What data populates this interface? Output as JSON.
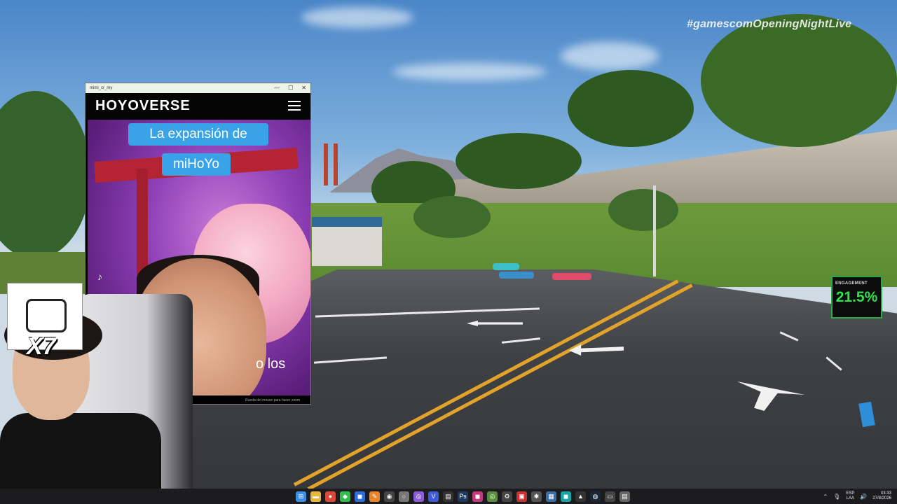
{
  "overlay": {
    "hashtag": "#gamescomOpeningNightLive",
    "engagement_label": "ENGAGEMENT",
    "engagement_value": "21.5%",
    "multiplier": "X7"
  },
  "popup": {
    "window_title": "mimi_cr_my",
    "brand": "HOYOVERSE",
    "caption_line1": "La expansión de",
    "caption_line2": "miHoYo",
    "subtitle_partial": "o los",
    "footer_hint": "Rueda del mouse para hacer zoom",
    "controls": {
      "minimize": "—",
      "maximize": "☐",
      "close": "✕"
    }
  },
  "taskbar": {
    "apps": [
      {
        "name": "start",
        "glyph": "⊞",
        "color": "#3a8ee6"
      },
      {
        "name": "file-explorer",
        "glyph": "▬",
        "color": "#e8b73a"
      },
      {
        "name": "chrome",
        "glyph": "●",
        "color": "#d94a38"
      },
      {
        "name": "app-green",
        "glyph": "◆",
        "color": "#2fbf4a"
      },
      {
        "name": "app-blue",
        "glyph": "◼",
        "color": "#2c6fdc"
      },
      {
        "name": "app-orange",
        "glyph": "✎",
        "color": "#e8832a"
      },
      {
        "name": "obs",
        "glyph": "◉",
        "color": "#444"
      },
      {
        "name": "app-white",
        "glyph": "○",
        "color": "#777"
      },
      {
        "name": "app-purple",
        "glyph": "◎",
        "color": "#8b5cd6"
      },
      {
        "name": "app-v",
        "glyph": "V",
        "color": "#3d5bd9"
      },
      {
        "name": "app-dark",
        "glyph": "▤",
        "color": "#333"
      },
      {
        "name": "photoshop",
        "glyph": "Ps",
        "color": "#1e3a63"
      },
      {
        "name": "app-pink",
        "glyph": "◼",
        "color": "#c23a7a"
      },
      {
        "name": "app-green2",
        "glyph": "◎",
        "color": "#5a8f3d"
      },
      {
        "name": "app-settings",
        "glyph": "⚙",
        "color": "#444"
      },
      {
        "name": "app-red",
        "glyph": "▣",
        "color": "#c73232"
      },
      {
        "name": "app-bug",
        "glyph": "✱",
        "color": "#555"
      },
      {
        "name": "app-media",
        "glyph": "▦",
        "color": "#3a6ea5"
      },
      {
        "name": "app-cyan",
        "glyph": "◼",
        "color": "#1aa3a3"
      },
      {
        "name": "epic",
        "glyph": "▲",
        "color": "#333"
      },
      {
        "name": "steam",
        "glyph": "◍",
        "color": "#1b2838"
      },
      {
        "name": "app-window",
        "glyph": "▭",
        "color": "#444"
      },
      {
        "name": "app-doc",
        "glyph": "▤",
        "color": "#666"
      }
    ],
    "tray": {
      "chevron": "⌃",
      "mic": "🎙",
      "lang_top": "ESP",
      "lang_bottom": "LAA",
      "speaker": "🔊",
      "time": "03:33",
      "date": "27/8/2026"
    }
  }
}
